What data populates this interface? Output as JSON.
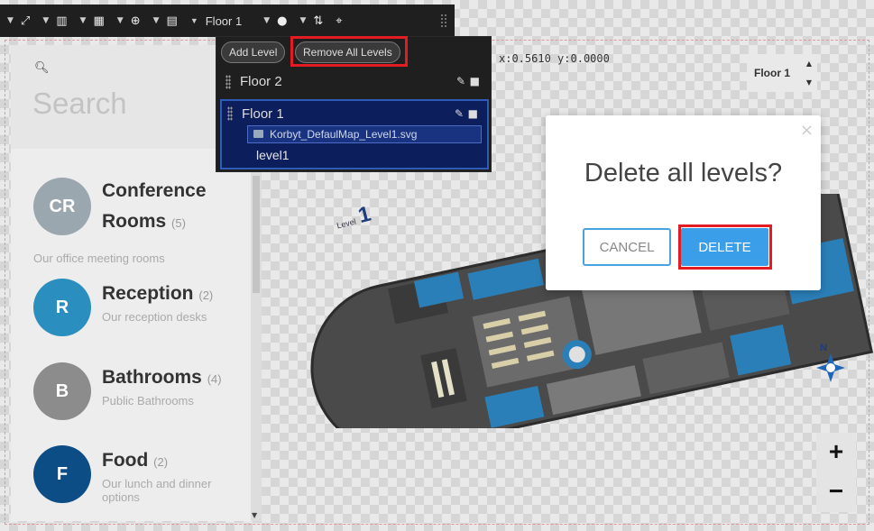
{
  "toolbar": {
    "items": [
      {
        "icon": "fullscreen-icon"
      },
      {
        "icon": "columns-icon"
      },
      {
        "icon": "grid-icon"
      },
      {
        "icon": "zoom-icon"
      },
      {
        "icon": "store-icon"
      }
    ],
    "floor_select": "Floor 1",
    "pin_icon": "map-pin-icon",
    "swap_icon": "swap-vertical-icon",
    "target_icon": "crosshair-icon"
  },
  "sidebar": {
    "search_placeholder": "Search",
    "categories": [
      {
        "initials": "CR",
        "name_line1": "Conference",
        "name_line2": "Rooms",
        "count": "(5)",
        "description": "Our office meeting rooms",
        "color": "#9aa7ae"
      },
      {
        "initials": "R",
        "name": "Reception",
        "count": "(2)",
        "description": "Our reception desks",
        "color": "#2a8fbf"
      },
      {
        "initials": "B",
        "name": "Bathrooms",
        "count": "(4)",
        "description": "Public Bathrooms",
        "color": "#8c8c8c"
      },
      {
        "initials": "F",
        "name": "Food",
        "count": "(2)",
        "description_line1": "Our lunch and dinner",
        "description_line2": "options",
        "color": "#0d4d86"
      }
    ]
  },
  "level_panel": {
    "add_label": "Add Level",
    "remove_label": "Remove All Levels",
    "levels": [
      {
        "name": "Floor 2"
      },
      {
        "name": "Floor 1",
        "file": "Korbyt_DefaulMap_Level1.svg",
        "id": "level1"
      }
    ]
  },
  "coords": {
    "x_label": "x:",
    "x": "0.5610",
    "y_label": "y:",
    "y": "0.0000"
  },
  "floor_picker": {
    "value": "Floor 1"
  },
  "map": {
    "level_small": "Level",
    "level_big": "1",
    "compass_label": "N"
  },
  "zoom": {
    "in": "+",
    "out": "−"
  },
  "dialog": {
    "title": "Delete all levels?",
    "cancel": "CANCEL",
    "delete": "DELETE",
    "close": "×"
  },
  "colors": {
    "highlight": "#e31b23",
    "accent": "#3a9ee8",
    "selected_level": "#0d1e5c"
  }
}
